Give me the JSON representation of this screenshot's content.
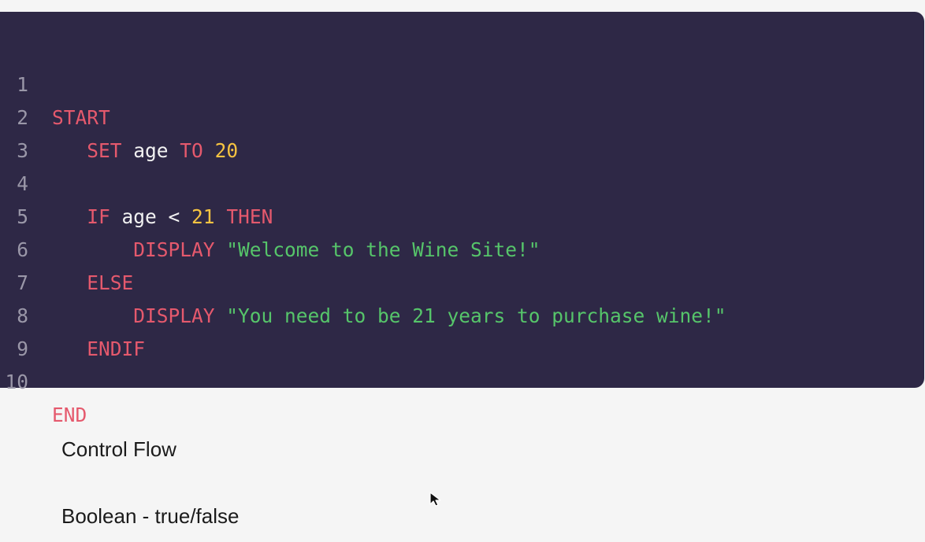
{
  "code": {
    "lines": [
      {
        "number": "1",
        "tokens": [
          {
            "text": "START",
            "type": "keyword"
          }
        ]
      },
      {
        "number": "2",
        "tokens": [
          {
            "text": "   ",
            "type": "space"
          },
          {
            "text": "SET",
            "type": "keyword"
          },
          {
            "text": " age ",
            "type": "identifier"
          },
          {
            "text": "TO",
            "type": "keyword"
          },
          {
            "text": " ",
            "type": "space"
          },
          {
            "text": "20",
            "type": "number"
          }
        ]
      },
      {
        "number": "3",
        "tokens": []
      },
      {
        "number": "4",
        "tokens": [
          {
            "text": "   ",
            "type": "space"
          },
          {
            "text": "IF",
            "type": "keyword"
          },
          {
            "text": " age < ",
            "type": "identifier"
          },
          {
            "text": "21",
            "type": "number"
          },
          {
            "text": " ",
            "type": "space"
          },
          {
            "text": "THEN",
            "type": "keyword"
          }
        ]
      },
      {
        "number": "5",
        "tokens": [
          {
            "text": "       ",
            "type": "space"
          },
          {
            "text": "DISPLAY",
            "type": "keyword"
          },
          {
            "text": " ",
            "type": "space"
          },
          {
            "text": "\"Welcome to the Wine Site!\"",
            "type": "string"
          }
        ]
      },
      {
        "number": "6",
        "tokens": [
          {
            "text": "   ",
            "type": "space"
          },
          {
            "text": "ELSE",
            "type": "keyword"
          }
        ]
      },
      {
        "number": "7",
        "tokens": [
          {
            "text": "       ",
            "type": "space"
          },
          {
            "text": "DISPLAY",
            "type": "keyword"
          },
          {
            "text": " ",
            "type": "space"
          },
          {
            "text": "\"You need to be 21 years to purchase wine!\"",
            "type": "string"
          }
        ]
      },
      {
        "number": "8",
        "tokens": [
          {
            "text": "   ",
            "type": "space"
          },
          {
            "text": "ENDIF",
            "type": "keyword"
          }
        ]
      },
      {
        "number": "9",
        "tokens": []
      },
      {
        "number": "10",
        "tokens": [
          {
            "text": "END",
            "type": "keyword"
          }
        ]
      }
    ]
  },
  "colors": {
    "code_background": "#2e2846",
    "keyword": "#e5596d",
    "identifier": "#f2f2f2",
    "number": "#f6c341",
    "string": "#56c56a",
    "line_number": "#9a97a8",
    "page_background": "#f5f5f5"
  },
  "labels": {
    "control_flow": "Control Flow",
    "boolean": "Boolean - true/false"
  },
  "cursor_icon": "arrow-cursor-icon"
}
